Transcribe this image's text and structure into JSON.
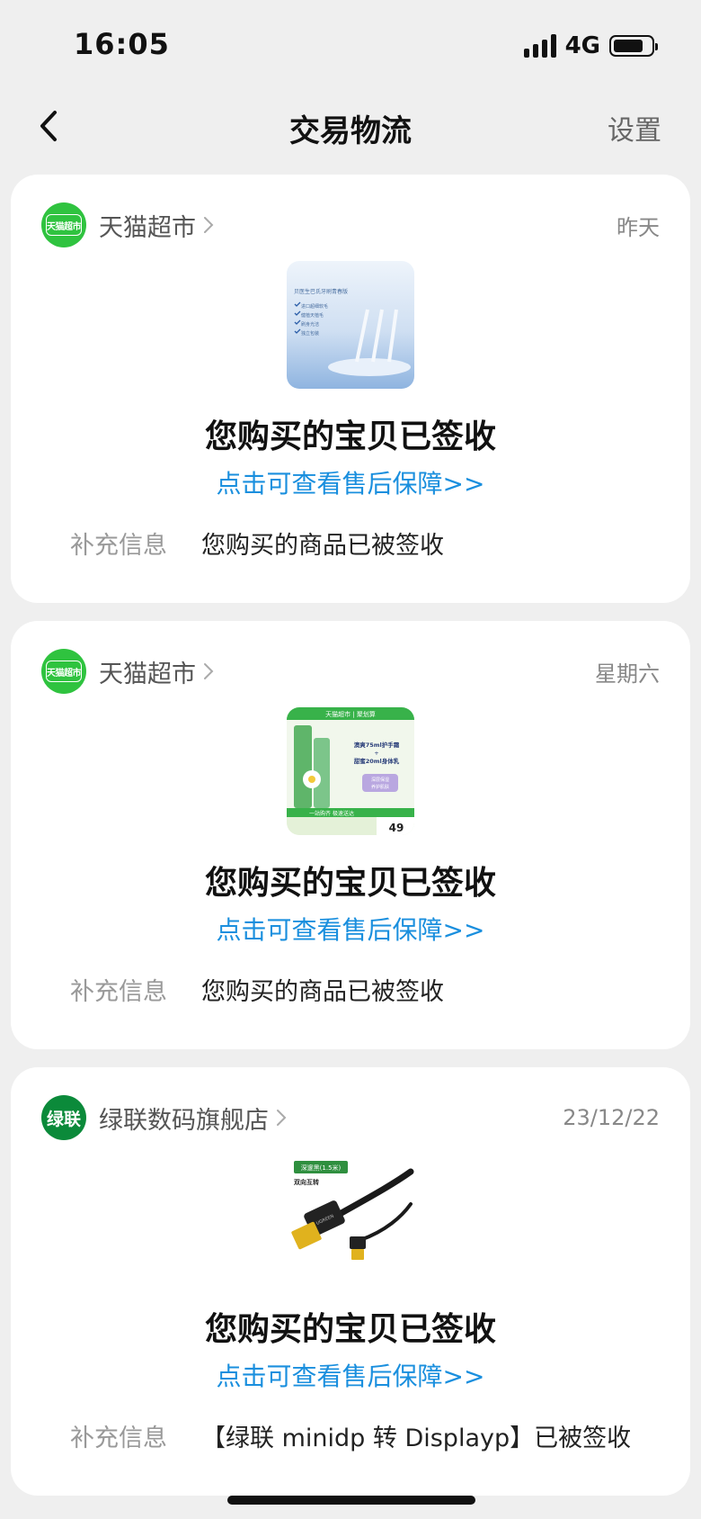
{
  "status_bar": {
    "time": "16:05",
    "network": "4G"
  },
  "nav": {
    "title": "交易物流",
    "settings_label": "设置"
  },
  "orders": [
    {
      "shop_name": "天猫超市",
      "shop_logo_text": "天猫超市",
      "date": "昨天",
      "status": "您购买的宝贝已签收",
      "after_sale_link": "点击可查看售后保障>>",
      "extra_label": "补充信息",
      "extra_value": "您购买的商品已被签收",
      "thumb_texts": [
        "贝医生巴氏牙刷青春版",
        "进口超细软毛",
        "健植天植毛",
        "刷身光洁",
        "独立包装"
      ]
    },
    {
      "shop_name": "天猫超市",
      "shop_logo_text": "天猫超市",
      "date": "星期六",
      "status": "您购买的宝贝已签收",
      "after_sale_link": "点击可查看售后保障>>",
      "extra_label": "补充信息",
      "extra_value": "您购买的商品已被签收",
      "thumb_texts": [
        "天猫超市 | 聚划算",
        "澳爽75ml护手霜",
        "+",
        "甜蜜20ml身体乳",
        "深层保湿",
        "养护肌肤",
        "一站购齐 极速送达",
        "49"
      ]
    },
    {
      "shop_name": "绿联数码旗舰店",
      "shop_logo_text": "绿联",
      "date": "23/12/22",
      "status": "您购买的宝贝已签收",
      "after_sale_link": "点击可查看售后保障>>",
      "extra_label": "补充信息",
      "extra_value": "【绿联 minidp 转 Displayp】已被签收",
      "thumb_texts": [
        "深邃黑(1.5米)",
        "双向互转",
        "UGREEN"
      ]
    }
  ],
  "colors": {
    "page_bg": "#efefef",
    "link_blue": "#1a8fde",
    "tmall_green": "#2fc33f",
    "ugreen_green": "#0b8a3a"
  },
  "icons": {
    "back": "chevron-left-icon",
    "shop_arrow": "chevron-right-icon",
    "signal": "signal-bars-icon",
    "battery": "battery-icon"
  }
}
